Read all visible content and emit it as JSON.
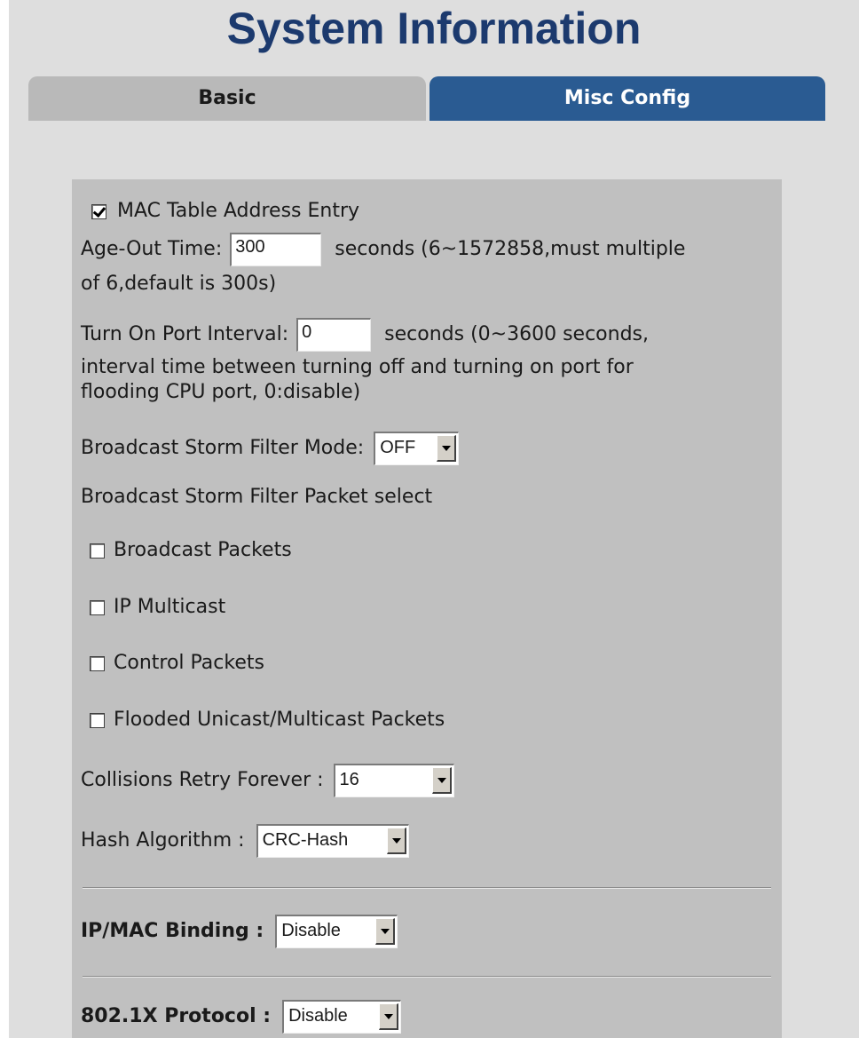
{
  "page_title": "System Information",
  "tabs": [
    {
      "label": "Basic",
      "active": false
    },
    {
      "label": "Misc Config",
      "active": true
    }
  ],
  "mac_table": {
    "checked": true,
    "label": "MAC Table Address Entry"
  },
  "age_out": {
    "label": "Age-Out Time:",
    "value": "300",
    "hint_line1": "seconds (6~1572858,must multiple",
    "hint_line2": "of 6,default is 300s)"
  },
  "port_interval": {
    "label": "Turn On Port Interval:",
    "value": "0",
    "hint_line1": "seconds (0~3600 seconds,",
    "hint_line2": "interval time between turning off and turning on port for",
    "hint_line3": "flooding CPU port, 0:disable)"
  },
  "storm_mode": {
    "label": "Broadcast Storm Filter Mode:",
    "selected": "OFF"
  },
  "storm_packet": {
    "label": "Broadcast Storm Filter Packet select",
    "options": [
      {
        "label": "Broadcast Packets",
        "checked": false
      },
      {
        "label": "IP Multicast",
        "checked": false
      },
      {
        "label": "Control Packets",
        "checked": false
      },
      {
        "label": "Flooded Unicast/Multicast Packets",
        "checked": false
      }
    ]
  },
  "collisions": {
    "label": "Collisions Retry Forever :",
    "selected": "16"
  },
  "hash": {
    "label": "Hash Algorithm :",
    "selected": "CRC-Hash"
  },
  "ip_mac_binding": {
    "label": "IP/MAC Binding :",
    "selected": "Disable"
  },
  "dot1x": {
    "label": "802.1X Protocol :",
    "selected": "Disable"
  },
  "colors": {
    "title": "#1c3a6e",
    "tab_active": "#2a5b92",
    "tab_inactive": "#b9b9b9",
    "panel": "#c0c0c0",
    "page_bg": "#dedede"
  }
}
